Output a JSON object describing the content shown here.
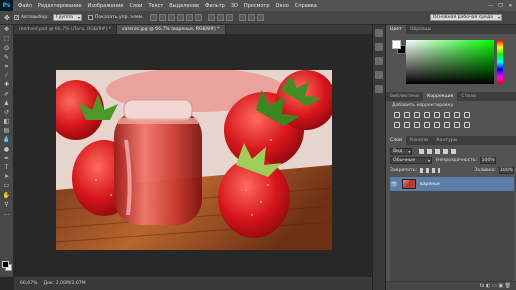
{
  "app": {
    "logo": "Ps"
  },
  "menu": [
    "Файл",
    "Редактирование",
    "Изображение",
    "Слои",
    "Текст",
    "Выделение",
    "Фильтр",
    "3D",
    "Просмотр",
    "Окно",
    "Справка"
  ],
  "window_controls": [
    "—",
    "❐",
    "✕"
  ],
  "options": {
    "autoselect_label": "Автовыбор:",
    "autoselect_value": "Группа",
    "transform_label": "Показать упр. элем."
  },
  "workspace": "Основная рабочая среда",
  "tabs": [
    {
      "label": "medved.psd @ 66,7% (Лого, RGB/8#) *",
      "active": false
    },
    {
      "label": "varenie.jpg @ 66,7% (варенье, RGB/8#) *",
      "active": true
    }
  ],
  "statusbar": {
    "zoom": "66,67%",
    "doc": "Док: 2,00М/2,67М"
  },
  "panels": {
    "color_tabs": [
      "Цвет",
      "Образцы"
    ],
    "adjust_tabs": [
      "Библиотеки",
      "Коррекция",
      "Стили"
    ],
    "adjust_title": "Добавить корректировку",
    "layer_tabs": [
      "Слои",
      "Каналы",
      "Контуры"
    ],
    "kind_label": "Вид",
    "blend_mode": "Обычные",
    "opacity_label": "Непрозрачность:",
    "opacity_value": "100%",
    "lock_label": "Закрепить:",
    "fill_label": "Заливка:",
    "fill_value": "100%",
    "layer_name": "варенье",
    "footer_icons": "fx ◐ ▭ ▣ 🗑"
  }
}
